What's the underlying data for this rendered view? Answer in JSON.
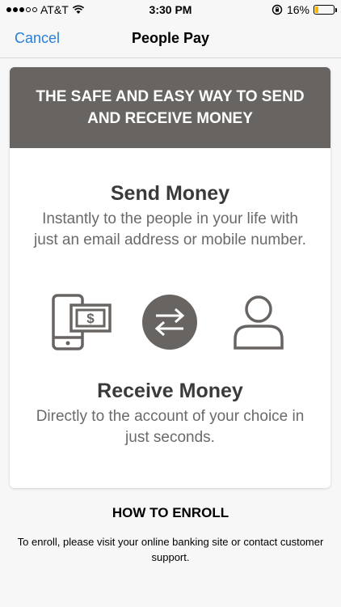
{
  "status": {
    "carrier": "AT&T",
    "time": "3:30 PM",
    "battery": "16%",
    "battery_level": 0.16,
    "icons": [
      "signal-dots-icon",
      "wifi-icon",
      "orientation-lock-icon",
      "battery-icon"
    ]
  },
  "nav": {
    "cancel": "Cancel",
    "title": "People Pay"
  },
  "banner": {
    "text": "THE SAFE AND EASY WAY TO SEND AND RECEIVE MONEY"
  },
  "send": {
    "title": "Send Money",
    "description": "Instantly to the people in your life with just an email address or mobile number."
  },
  "icons": {
    "phone_dollar": "phone-dollar-icon",
    "swap": "swap-arrows-icon",
    "person": "person-icon",
    "dollar_sign": "$",
    "swap_color": "#686462"
  },
  "receive": {
    "title": "Receive Money",
    "description": "Directly to the account of your choice in just seconds."
  },
  "enroll": {
    "heading": "HOW TO ENROLL",
    "text": "To enroll, please visit your online banking site or contact customer support."
  },
  "colors": {
    "banner": "#686462",
    "link": "#2a7fd4",
    "battery": "#f5b700"
  }
}
